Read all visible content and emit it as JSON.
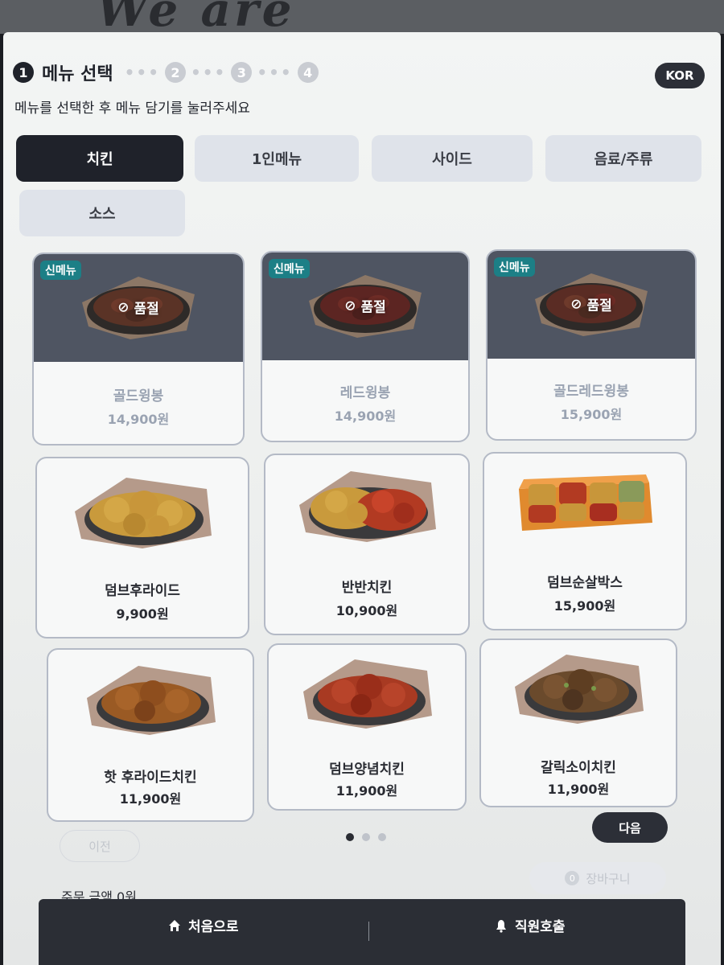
{
  "header": {
    "steps": [
      {
        "num": "1",
        "label": "메뉴 선택"
      },
      {
        "num": "2"
      },
      {
        "num": "3"
      },
      {
        "num": "4"
      }
    ],
    "language": "KOR",
    "subtitle": "메뉴를 선택한 후 메뉴 담기를 눌러주세요"
  },
  "tabs": [
    {
      "label": "치킨",
      "active": true
    },
    {
      "label": "1인메뉴",
      "active": false
    },
    {
      "label": "사이드",
      "active": false
    },
    {
      "label": "음료/주류",
      "active": false
    },
    {
      "label": "소스",
      "active": false
    }
  ],
  "products": [
    {
      "name": "골드윙봉",
      "price": "14,900원",
      "badge": "신메뉴",
      "status": "품절"
    },
    {
      "name": "레드윙봉",
      "price": "14,900원",
      "badge": "신메뉴",
      "status": "품절"
    },
    {
      "name": "골드레드윙봉",
      "price": "15,900원",
      "badge": "신메뉴",
      "status": "품절"
    },
    {
      "name": "덤브후라이드",
      "price": "9,900원"
    },
    {
      "name": "반반치킨",
      "price": "10,900원"
    },
    {
      "name": "덤브순살박스",
      "price": "15,900원"
    },
    {
      "name": "핫 후라이드치킨",
      "price": "11,900원"
    },
    {
      "name": "덤브양념치킨",
      "price": "11,900원"
    },
    {
      "name": "갈릭소이치킨",
      "price": "11,900원"
    }
  ],
  "pager": {
    "pages": 3,
    "current": 1
  },
  "nav": {
    "prev": "이전",
    "next": "다음"
  },
  "cart": {
    "label": "장바구니",
    "count": "0"
  },
  "order_total": "주문 금액 0원",
  "bottom": {
    "home": "처음으로",
    "call_staff": "직원호출"
  },
  "colors": {
    "primary": "#1f222a",
    "badge": "#1c7f86",
    "tab_inactive": "#dfe3ea"
  }
}
